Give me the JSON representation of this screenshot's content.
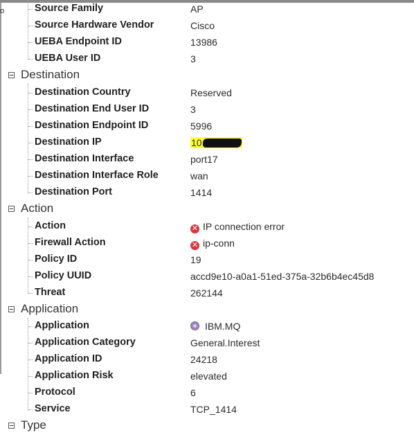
{
  "source": {
    "fields": [
      {
        "label": "Source Family",
        "value": "AP"
      },
      {
        "label": "Source Hardware Vendor",
        "value": "Cisco"
      },
      {
        "label": "UEBA Endpoint ID",
        "value": "13986"
      },
      {
        "label": "UEBA User ID",
        "value": "3"
      }
    ]
  },
  "destination": {
    "title": "Destination",
    "fields": [
      {
        "label": "Destination Country",
        "value": "Reserved"
      },
      {
        "label": "Destination End User ID",
        "value": "3"
      },
      {
        "label": "Destination Endpoint ID",
        "value": "5996"
      },
      {
        "label": "Destination IP",
        "value": "10."
      },
      {
        "label": "Destination Interface",
        "value": "port17"
      },
      {
        "label": "Destination Interface Role",
        "value": "wan"
      },
      {
        "label": "Destination Port",
        "value": "1414"
      }
    ]
  },
  "action": {
    "title": "Action",
    "fields": [
      {
        "label": "Action",
        "value": "IP connection error",
        "icon": "error-icon"
      },
      {
        "label": "Firewall Action",
        "value": "ip-conn",
        "icon": "error-icon"
      },
      {
        "label": "Policy ID",
        "value": "19"
      },
      {
        "label": "Policy UUID",
        "value": "accd9e10-a0a1-51ed-375a-32b6b4ec45d8"
      },
      {
        "label": "Threat",
        "value": "262144"
      }
    ]
  },
  "application": {
    "title": "Application",
    "fields": [
      {
        "label": "Application",
        "value": "IBM.MQ",
        "icon": "application-icon"
      },
      {
        "label": "Application Category",
        "value": "General.Interest"
      },
      {
        "label": "Application ID",
        "value": "24218"
      },
      {
        "label": "Application Risk",
        "value": "elevated"
      },
      {
        "label": "Protocol",
        "value": "6"
      },
      {
        "label": "Service",
        "value": "TCP_1414"
      }
    ]
  },
  "type_section": {
    "title": "Type"
  },
  "edge_glyph": "o",
  "error_glyph": "✕",
  "colors": {
    "error": "#d9363e",
    "highlight": "#ffff33",
    "app_icon": "#9b86b9"
  }
}
